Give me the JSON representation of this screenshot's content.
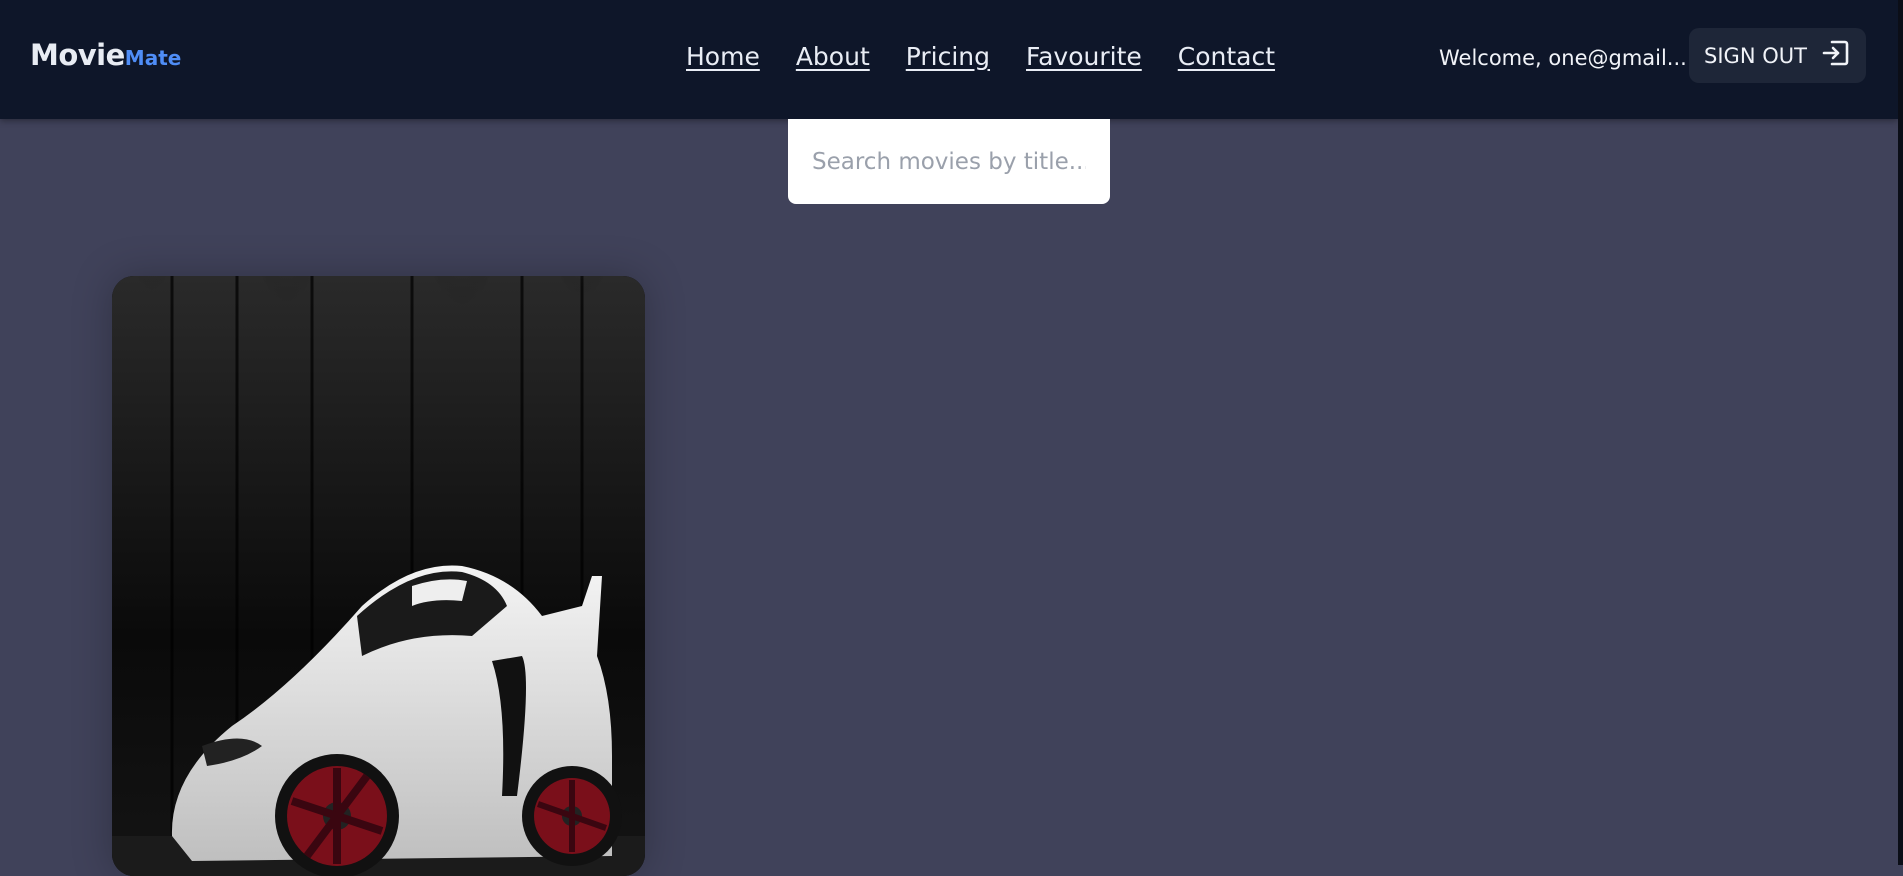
{
  "brand": {
    "main": "Movie",
    "accent": "Mate"
  },
  "nav": {
    "links": [
      {
        "label": "Home"
      },
      {
        "label": "About"
      },
      {
        "label": "Pricing"
      },
      {
        "label": "Favourite"
      },
      {
        "label": "Contact"
      }
    ]
  },
  "user": {
    "welcome": "Welcome, one@gmail....",
    "signout_label": "SIGN OUT",
    "signout_icon": "sign-out-icon"
  },
  "search": {
    "placeholder": "Search movies by title..."
  },
  "movies": [
    {
      "poster": "white sports car in dark garage"
    }
  ],
  "colors": {
    "navbar": "#0e1629",
    "background": "#40425a",
    "accent": "#4f8df6",
    "signout_bg": "#1e2638"
  }
}
